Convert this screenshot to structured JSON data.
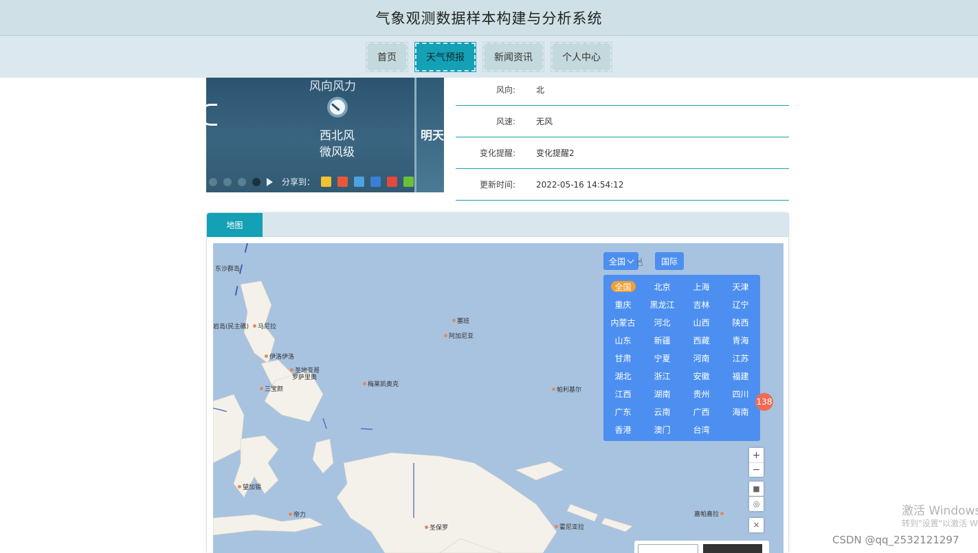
{
  "header": {
    "title": "气象观测数据样本构建与分析系统"
  },
  "nav": {
    "items": [
      {
        "label": "首页",
        "active": false
      },
      {
        "label": "天气预报",
        "active": true
      },
      {
        "label": "新闻资讯",
        "active": false
      },
      {
        "label": "个人中心",
        "active": false
      }
    ]
  },
  "weather_image": {
    "wind_label": "风向风力",
    "wind_dir": "西北风",
    "wind_level": "微风级",
    "next_label": "明天",
    "share_label": "分享到："
  },
  "info": {
    "wind_dir_key": "风向:",
    "wind_dir_val": "北",
    "wind_speed_key": "风速:",
    "wind_speed_val": "无风",
    "change_key": "变化提醒:",
    "change_val": "变化提醒2",
    "update_key": "更新时间:",
    "update_val": "2022-05-16 14:54:12"
  },
  "map": {
    "tab_label": "地图",
    "btn_china": "全国",
    "btn_intl": "国际",
    "regions": [
      "全国",
      "北京",
      "上海",
      "天津",
      "重庆",
      "黑龙江",
      "吉林",
      "辽宁",
      "内蒙古",
      "河北",
      "山西",
      "陕西",
      "山东",
      "新疆",
      "西藏",
      "青海",
      "甘肃",
      "宁夏",
      "河南",
      "江苏",
      "湖北",
      "浙江",
      "安徽",
      "福建",
      "江西",
      "湖南",
      "贵州",
      "四川",
      "广东",
      "云南",
      "广西",
      "海南",
      "香港",
      "澳门",
      "台湾"
    ],
    "selected_region": "全国",
    "badge_count": "138",
    "zoom_in": "+",
    "zoom_out": "−",
    "places": {
      "p1": "东沙群岛",
      "p2": "岩岛(民主礁)",
      "p3": "马尼拉",
      "p4": "塞班",
      "p5": "阿加尼亚",
      "p6": "伊洛伊洛",
      "p7": "圣地亚哥",
      "p8": "罗萨里奥",
      "p9": "三宝颜",
      "p10": "梅莱凯奥克",
      "p11": "帕利基尔",
      "p12": "望加锡",
      "p13": "帝力",
      "p14": "圣保罗",
      "p15": "霍尼亚拉",
      "p16": "嘉帕嘉拉"
    }
  },
  "watermarks": {
    "windows_line1": "激活 Windows",
    "windows_line2": "转到\"设置\"以激活 W",
    "csdn": "CSDN @qq_2532121297"
  }
}
